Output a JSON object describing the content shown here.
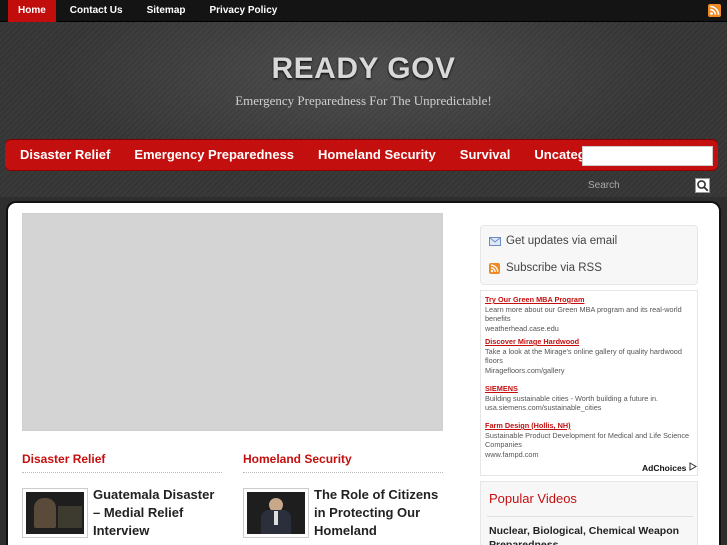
{
  "topnav": {
    "items": [
      "Home",
      "Contact Us",
      "Sitemap",
      "Privacy Policy"
    ],
    "active": "Home"
  },
  "header": {
    "title": "READY GOV",
    "tagline": "Emergency Preparedness For The Unpredictable!"
  },
  "mainnav": {
    "items": [
      "Disaster Relief",
      "Emergency Preparedness",
      "Homeland Security",
      "Survival",
      "Uncategorized"
    ]
  },
  "search": {
    "placeholder": "Search"
  },
  "sections": [
    {
      "title": "Disaster Relief",
      "post_title": "Guatemala Disaster – Medial Relief Interview"
    },
    {
      "title": "Homeland Security",
      "post_title": "The Role of Citizens in Protecting Our Homeland"
    }
  ],
  "subscribe": {
    "email": "Get updates via email",
    "rss": "Subscribe via RSS"
  },
  "ads": [
    {
      "title": "Try Our Green MBA Program",
      "text": "Learn more about our Green MBA program and its real-world benefits",
      "url": "weatherhead.case.edu"
    },
    {
      "title": "Discover Mirage Hardwood",
      "text": "Take a look at the Mirage's online gallery of quality hardwood floors",
      "url": "Miragefloors.com/gallery"
    },
    {
      "title": "SIEMENS",
      "text": "Building sustainable cities - Worth building a future in.",
      "url": "usa.siemens.com/sustainable_cities"
    },
    {
      "title": "Farm Design (Hollis, NH)",
      "text": "Sustainable Product Development for Medical and Life Science Companies",
      "url": "www.fampd.com"
    }
  ],
  "adchoices": "AdChoices",
  "popular": {
    "title": "Popular Videos",
    "first_item": "Nuclear, Biological, Chemical Weapon Preparedness"
  },
  "colors": {
    "accent": "#c40f0f",
    "topbar": "#141414",
    "rss": "#f08a24"
  },
  "icons": [
    "rss-icon",
    "email-icon",
    "search-icon",
    "adchoices-icon"
  ]
}
